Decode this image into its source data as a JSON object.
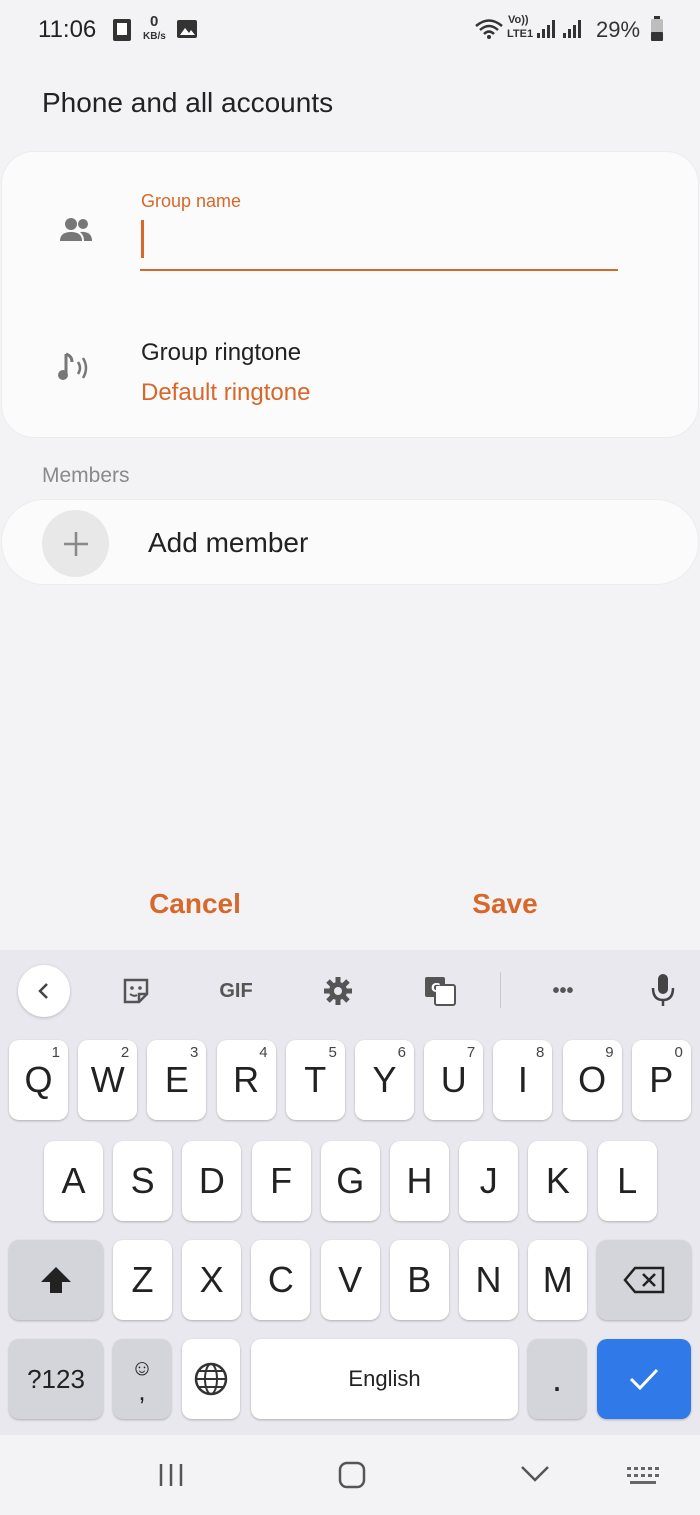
{
  "status_bar": {
    "time": "11:06",
    "net_speed_value": "0",
    "net_speed_unit": "KB/s",
    "network_label_top": "Vo))",
    "network_label_bottom": "LTE1",
    "battery": "29%"
  },
  "page": {
    "title": "Phone and all accounts"
  },
  "group_card": {
    "name_label": "Group name",
    "name_value": "",
    "ringtone_title": "Group ringtone",
    "ringtone_value": "Default ringtone"
  },
  "members": {
    "section_label": "Members",
    "add_member_label": "Add member"
  },
  "actions": {
    "cancel_label": "Cancel",
    "save_label": "Save"
  },
  "keyboard": {
    "toolbar": {
      "gif_label": "GIF",
      "more_label": "•••"
    },
    "row1": [
      {
        "key": "Q",
        "num": "1"
      },
      {
        "key": "W",
        "num": "2"
      },
      {
        "key": "E",
        "num": "3"
      },
      {
        "key": "R",
        "num": "4"
      },
      {
        "key": "T",
        "num": "5"
      },
      {
        "key": "Y",
        "num": "6"
      },
      {
        "key": "U",
        "num": "7"
      },
      {
        "key": "I",
        "num": "8"
      },
      {
        "key": "O",
        "num": "9"
      },
      {
        "key": "P",
        "num": "0"
      }
    ],
    "row2": [
      "A",
      "S",
      "D",
      "F",
      "G",
      "H",
      "J",
      "K",
      "L"
    ],
    "row3": [
      "Z",
      "X",
      "C",
      "V",
      "B",
      "N",
      "M"
    ],
    "symbols_label": "?123",
    "emoji_top": "☺",
    "emoji_bottom": ",",
    "space_label": "English",
    "period_label": "."
  },
  "colors": {
    "accent": "#d7672a",
    "enter_key": "#2f79e8"
  }
}
